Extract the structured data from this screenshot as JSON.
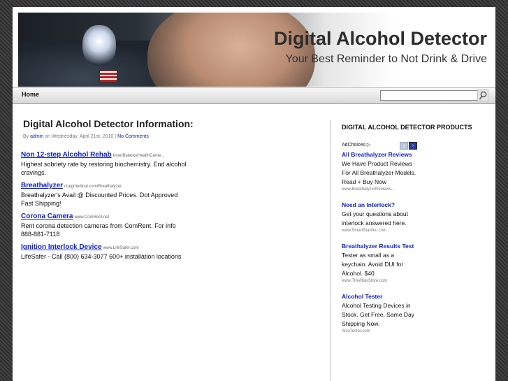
{
  "site": {
    "title": "Digital Alcohol Detector",
    "tagline": "Your Best Reminder to Not Drink & Drive"
  },
  "nav": {
    "home": "Home"
  },
  "search": {
    "placeholder": ""
  },
  "post": {
    "title": "Digital Alcohol Detector Information:",
    "meta_by": "By",
    "author": "admin",
    "meta_date": "on Wednesday, April 21st, 2010 |",
    "comments": "No Comments"
  },
  "ads": [
    {
      "title": "Non 12-step Alcohol Rehab",
      "url": "InnerBalanceHealthCente...",
      "desc": "Highest sobriety rate by restoring biochemistry. End alcohol cravings."
    },
    {
      "title": "Breathalyzer",
      "url": "craigmedical.com/Breathalyzer",
      "desc": "Breathalyzer's Avail @ Discounted Prices. Dot Approved Fast Shipping!"
    },
    {
      "title": "Corona Camera",
      "url": "www.ComRent.net",
      "desc": "Rent corona detection cameras from ComRent. For info 888-881-7118"
    },
    {
      "title": "Ignition Interlock Device",
      "url": "www.LifeSafer.com",
      "desc": "LifeSafer - Call (800) 634-3077 600+ installation locations"
    }
  ],
  "sidebar": {
    "title": "DIGITAL ALCOHOL DETECTOR PRODUCTS",
    "adchoices": "AdChoices ▷",
    "prev": "‹",
    "next": "›",
    "ads": [
      {
        "title": "All Breathalyzer Reviews",
        "desc": "We Have Product Reviews For All Breathalyzer Models. Read + Buy Now",
        "url": "www.BreathalyzerReviews..."
      },
      {
        "title": "Need an Interlock?",
        "desc": "Get your questions about interlock answered here.",
        "url": "www.SmartStartInc.com"
      },
      {
        "title": "Breathalyzer Results Test",
        "desc": "Tester as small as a keychain. Avoid DUI for Alcohol. $40",
        "url": "www.TheAtlasStore.com"
      },
      {
        "title": "Alcohol Tester",
        "desc": "Alcohol Testing Devices in Stock. Get Free, Same Day Shipping Now.",
        "url": "AlcoTester.com"
      }
    ]
  }
}
